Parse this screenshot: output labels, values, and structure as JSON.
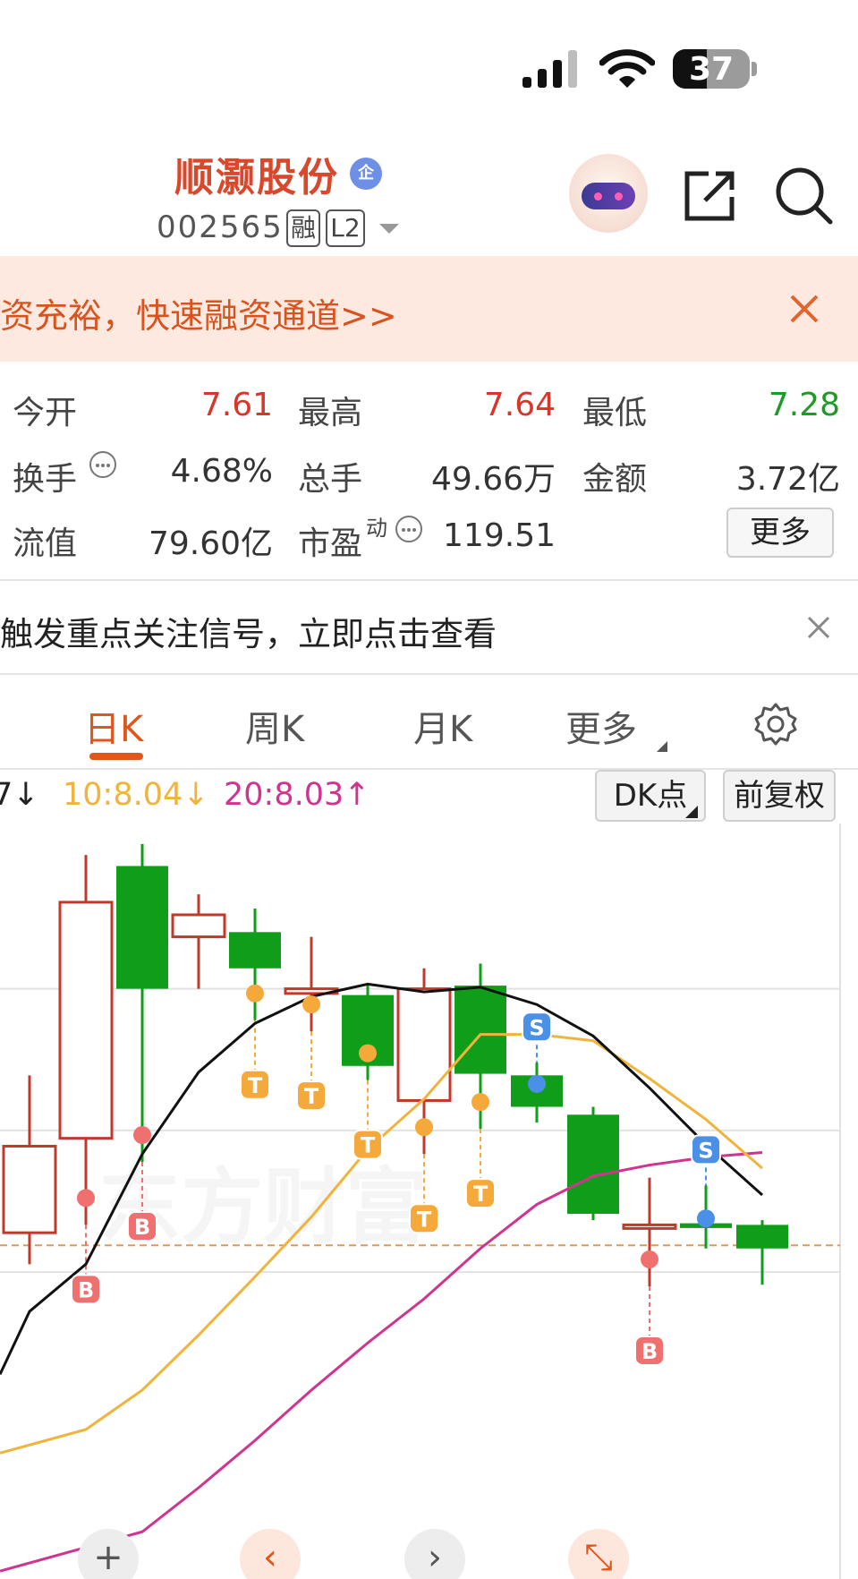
{
  "status_bar": {
    "battery_level": "37",
    "icons": [
      "signal-icon",
      "wifi-icon",
      "battery-icon"
    ]
  },
  "header": {
    "stock_name": "顺灏股份",
    "enterprise_badge": "企",
    "stock_code": "002565",
    "tag_margin": "融",
    "tag_level2": "L2",
    "icons": [
      "assistant-robot-icon",
      "share-icon",
      "search-icon"
    ]
  },
  "banner": {
    "text": "资充裕，快速融资通道>>"
  },
  "quote": {
    "open_label": "今开",
    "open_value": "7.61",
    "high_label": "最高",
    "high_value": "7.64",
    "low_label": "最低",
    "low_value": "7.28",
    "turnover_label": "换手",
    "turnover_value": "4.68%",
    "volume_label": "总手",
    "volume_value": "49.66万",
    "amount_label": "金额",
    "amount_value": "3.72亿",
    "float_cap_label": "流值",
    "float_cap_value": "79.60亿",
    "pe_label": "市盈",
    "pe_sup": "动",
    "pe_value": "119.51",
    "more_label": "更多"
  },
  "signal_bar": {
    "text": "触发重点关注信号，立即点击查看"
  },
  "tabs": {
    "items": [
      "日K",
      "周K",
      "月K",
      "更多"
    ],
    "active": "日K"
  },
  "ma_row": {
    "ma5": "7↓",
    "ma10": "10:8.04↓",
    "ma20": "20:8.03↑",
    "dk_label": "DK点",
    "adjust_label": "前复权"
  },
  "colors": {
    "up": "#c0392b",
    "down": "#0f9d1a",
    "ma5": "#111111",
    "ma10": "#f0b43c",
    "ma20": "#d0348e",
    "accent": "#e0571c"
  },
  "chart_data": {
    "type": "candlestick",
    "watermark": "东方财富",
    "candles": [
      {
        "open": 8.8,
        "close": 9.35,
        "high": 9.8,
        "low": 8.6
      },
      {
        "open": 9.4,
        "close": 10.9,
        "high": 11.2,
        "low": 8.85
      },
      {
        "open": 11.13,
        "close": 10.35,
        "high": 11.27,
        "low": 9.25
      },
      {
        "open": 10.68,
        "close": 10.82,
        "high": 10.95,
        "low": 10.35
      },
      {
        "open": 10.71,
        "close": 10.48,
        "high": 10.86,
        "low": 10.15
      },
      {
        "open": 10.32,
        "close": 10.35,
        "high": 10.68,
        "low": 10.08
      },
      {
        "open": 10.31,
        "close": 9.86,
        "high": 10.38,
        "low": 9.77
      },
      {
        "open": 9.64,
        "close": 10.35,
        "high": 10.48,
        "low": 9.3
      },
      {
        "open": 10.37,
        "close": 9.81,
        "high": 10.51,
        "low": 9.46
      },
      {
        "open": 9.8,
        "close": 9.6,
        "high": 9.88,
        "low": 9.5
      },
      {
        "open": 9.55,
        "close": 8.92,
        "high": 9.6,
        "low": 8.88
      },
      {
        "open": 8.83,
        "close": 8.85,
        "high": 9.15,
        "low": 8.46
      },
      {
        "open": 8.86,
        "close": 8.83,
        "high": 9.1,
        "low": 8.7
      },
      {
        "open": 8.85,
        "close": 8.7,
        "high": 8.88,
        "low": 8.47
      }
    ],
    "ma5": [
      8.3,
      8.6,
      9.3,
      9.82,
      10.13,
      10.3,
      10.38,
      10.33,
      10.36,
      10.25,
      10.05,
      9.72,
      9.36,
      9.04
    ],
    "ma10": [
      null,
      7.55,
      7.8,
      8.15,
      8.52,
      8.9,
      9.33,
      9.65,
      10.06,
      10.06,
      10.02,
      9.78,
      9.52,
      9.21
    ],
    "ma20": [
      null,
      null,
      6.9,
      7.18,
      7.48,
      7.8,
      8.1,
      8.38,
      8.7,
      8.98,
      9.16,
      9.23,
      9.28,
      9.31
    ],
    "reference_price": 8.72,
    "markers": [
      {
        "candle": 1,
        "label": "B"
      },
      {
        "candle": 2,
        "label": "B"
      },
      {
        "candle": 4,
        "label": "T"
      },
      {
        "candle": 5,
        "label": "T"
      },
      {
        "candle": 6,
        "label": "T"
      },
      {
        "candle": 7,
        "label": "T"
      },
      {
        "candle": 8,
        "label": "T"
      },
      {
        "candle": 9,
        "label": "S"
      },
      {
        "candle": 11,
        "label": "B"
      },
      {
        "candle": 12,
        "label": "S"
      }
    ]
  },
  "chart_controls": {
    "zoom_in_icon": "+",
    "prev_icon": "‹",
    "next_icon": "›",
    "fullscreen_icon": "⤡"
  }
}
